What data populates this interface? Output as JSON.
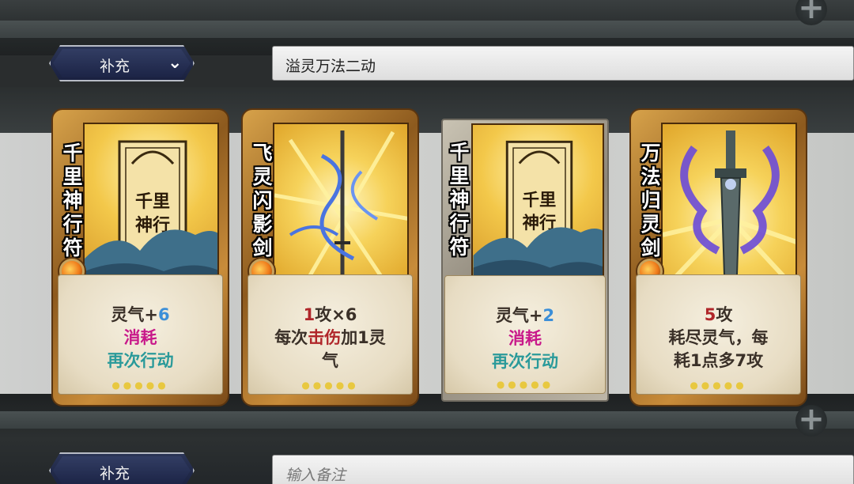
{
  "top_row": {
    "dropdown_label": "补充",
    "note_value": "溢灵万法二动"
  },
  "bottom_row": {
    "dropdown_label": "补充",
    "note_placeholder": "输入备注"
  },
  "cards": [
    {
      "title": "千里神行符",
      "lines": [
        {
          "parts": [
            {
              "t": "灵气+",
              "c": ""
            },
            {
              "t": "6",
              "c": "blue"
            }
          ]
        },
        {
          "parts": [
            {
              "t": "消耗",
              "c": "mag"
            }
          ]
        },
        {
          "parts": [
            {
              "t": "再次行动",
              "c": "teal"
            }
          ]
        }
      ]
    },
    {
      "title": "飞灵闪影剑",
      "lines": [
        {
          "parts": [
            {
              "t": "1",
              "c": "red"
            },
            {
              "t": "攻×6",
              "c": ""
            }
          ]
        },
        {
          "parts": [
            {
              "t": "每次",
              "c": ""
            },
            {
              "t": "击伤",
              "c": "red"
            },
            {
              "t": "加1灵",
              "c": ""
            }
          ]
        },
        {
          "parts": [
            {
              "t": "气",
              "c": ""
            }
          ]
        }
      ]
    },
    {
      "title": "千里神行符",
      "lines": [
        {
          "parts": [
            {
              "t": "灵气+",
              "c": ""
            },
            {
              "t": "2",
              "c": "blue"
            }
          ]
        },
        {
          "parts": [
            {
              "t": "消耗",
              "c": "mag"
            }
          ]
        },
        {
          "parts": [
            {
              "t": "再次行动",
              "c": "teal"
            }
          ]
        }
      ]
    },
    {
      "title": "万法归灵剑",
      "lines": [
        {
          "parts": [
            {
              "t": "5",
              "c": "red"
            },
            {
              "t": "攻",
              "c": ""
            }
          ]
        },
        {
          "parts": [
            {
              "t": "耗尽灵气，每",
              "c": ""
            }
          ]
        },
        {
          "parts": [
            {
              "t": "耗1点多7攻",
              "c": ""
            }
          ]
        }
      ]
    }
  ],
  "colors": {
    "accent_blue": "#3c8fd8",
    "accent_red": "#b0262a",
    "accent_magenta": "#c8198a",
    "accent_teal": "#2a9a9a"
  }
}
